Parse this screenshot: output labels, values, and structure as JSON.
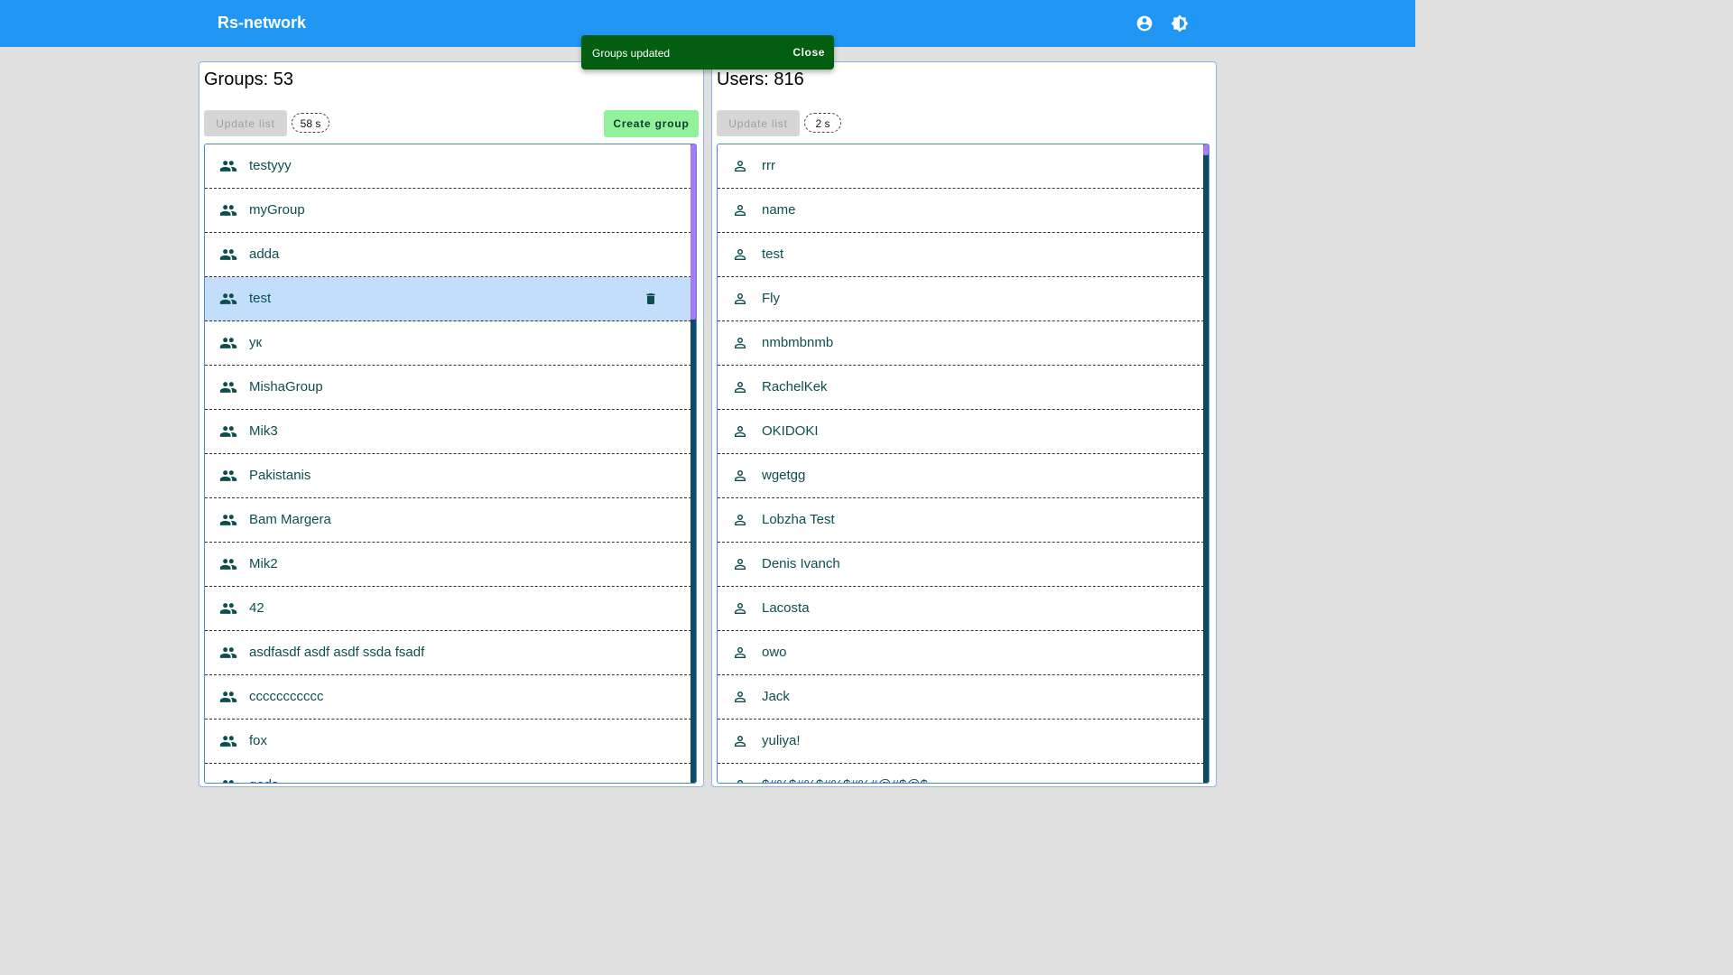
{
  "app": {
    "title": "Rs-network",
    "header_icons": [
      "account-circle-icon",
      "brightness-icon"
    ]
  },
  "toast": {
    "message": "Groups updated",
    "close_label": "Close",
    "color": "#045e12"
  },
  "groups": {
    "title": "Groups: 53",
    "update_label": "Update list",
    "timer": "58 s",
    "create_label": "Create group",
    "selected_index": 3,
    "items": [
      "testyyy",
      "myGroup",
      "adda",
      "test",
      "ук",
      "MishaGroup",
      "Mik3",
      "Pakistanis",
      "Bam Margera",
      "Mik2",
      "42",
      "asdfasdf asdf asdf ssda fsadf",
      "ccccccccccc",
      "fox",
      "gods"
    ]
  },
  "users": {
    "title": "Users: 816",
    "update_label": "Update list",
    "timer": "2 s",
    "items": [
      "rrr",
      "name",
      "test",
      "Fly",
      "nmbmbnmb",
      "RachelKek",
      "OKIDOKI",
      "wgetgg",
      "Lobzha Test",
      "Denis Ivanch",
      "Lacosta",
      "owo",
      "Jack",
      "yuliya!",
      "$#%$#%$#%$#%#@#$@$"
    ]
  },
  "colors": {
    "header": "#2196f3",
    "accent_green": "#90f29a",
    "selected_row": "#c3defa",
    "text": "#0d4f4f"
  }
}
